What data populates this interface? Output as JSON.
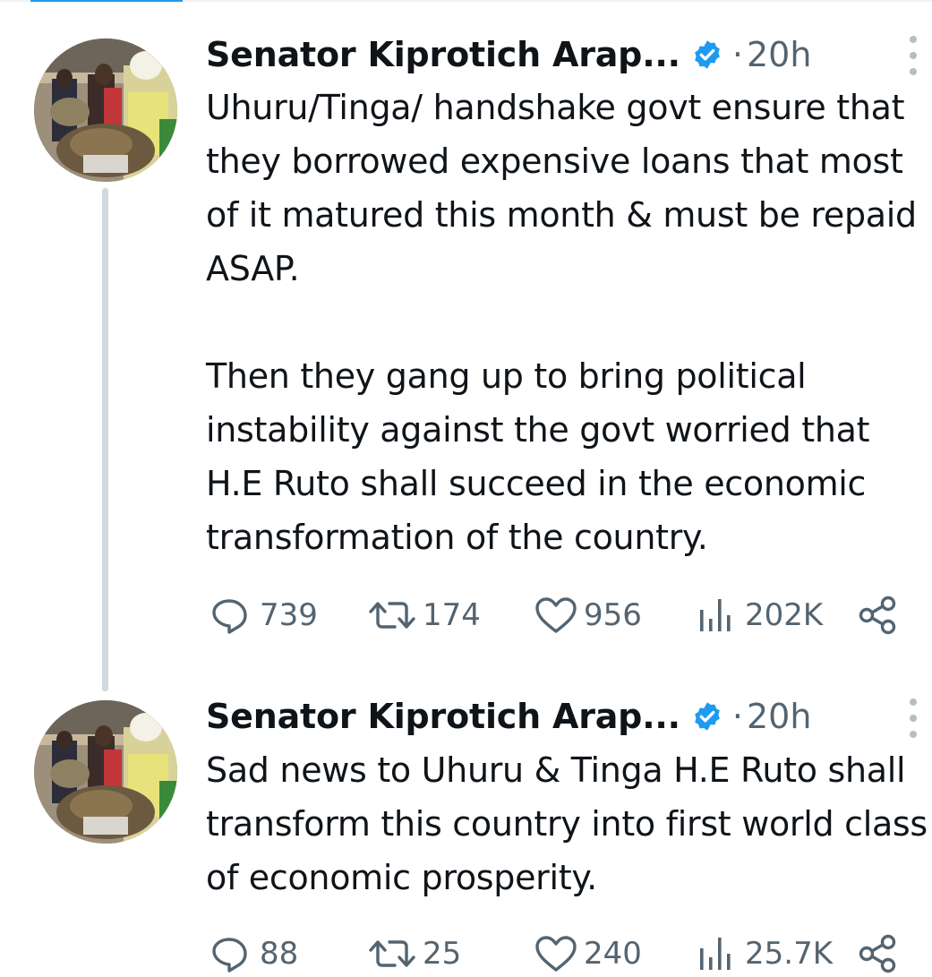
{
  "colors": {
    "verified_badge": "#1d9bf0",
    "secondary_text": "#536471",
    "thread_line": "#cfd9de",
    "primary_text": "#0f1419"
  },
  "tweets": [
    {
      "author": "Senator Kiprotich Arap...",
      "separator": "·",
      "time": "20h",
      "text": "Uhuru/Tinga/ handshake govt ensure that they borrowed expensive loans that most of it matured this month & must be repaid ASAP.\n\nThen they gang up to bring political instability against the govt worried that H.E Ruto shall succeed in the economic transformation of the country.",
      "replies": "739",
      "retweets": "174",
      "likes": "956",
      "views": "202K",
      "icons": [
        "reply-icon",
        "retweet-icon",
        "like-icon",
        "views-icon",
        "share-icon"
      ]
    },
    {
      "author": "Senator Kiprotich Arap...",
      "separator": "·",
      "time": "20h",
      "text": "Sad news to Uhuru & Tinga H.E Ruto shall transform this country into first world class of economic prosperity.",
      "replies": "88",
      "retweets": "25",
      "likes": "240",
      "views": "25.7K",
      "icons": [
        "reply-icon",
        "retweet-icon",
        "like-icon",
        "views-icon",
        "share-icon"
      ]
    }
  ]
}
